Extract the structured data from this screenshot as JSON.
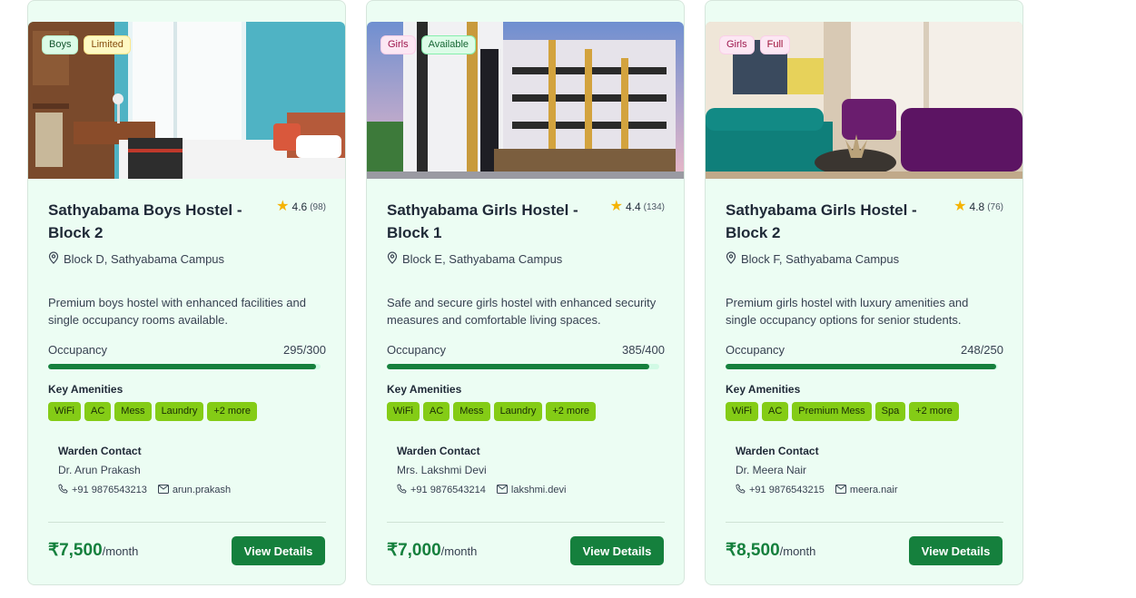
{
  "hostels": [
    {
      "gender_badge": "Boys",
      "status_badge": "Limited",
      "title": "Sathyabama Boys Hostel - Block 2",
      "rating": "4.6",
      "reviews": "(98)",
      "location": "Block D, Sathyabama Campus",
      "description": "Premium boys hostel with enhanced facilities and single occupancy rooms available.",
      "occupancy_label": "Occupancy",
      "occupancy_value": "295/300",
      "occupancy_fraction": 0.983,
      "amenities_title": "Key Amenities",
      "amenities": [
        "WiFi",
        "AC",
        "Mess",
        "Laundry",
        "+2 more"
      ],
      "warden_title": "Warden Contact",
      "warden_name": "Dr. Arun Prakash",
      "warden_phone": "+91 9876543213",
      "warden_email": "arun.prakash",
      "price": "₹7,500",
      "per": "/month",
      "button": "View Details"
    },
    {
      "gender_badge": "Girls",
      "status_badge": "Available",
      "title": "Sathyabama Girls Hostel - Block 1",
      "rating": "4.4",
      "reviews": "(134)",
      "location": "Block E, Sathyabama Campus",
      "description": "Safe and secure girls hostel with enhanced security measures and comfortable living spaces.",
      "occupancy_label": "Occupancy",
      "occupancy_value": "385/400",
      "occupancy_fraction": 0.9625,
      "amenities_title": "Key Amenities",
      "amenities": [
        "WiFi",
        "AC",
        "Mess",
        "Laundry",
        "+2 more"
      ],
      "warden_title": "Warden Contact",
      "warden_name": "Mrs. Lakshmi Devi",
      "warden_phone": "+91 9876543214",
      "warden_email": "lakshmi.devi",
      "price": "₹7,000",
      "per": "/month",
      "button": "View Details"
    },
    {
      "gender_badge": "Girls",
      "status_badge": "Full",
      "title": "Sathyabama Girls Hostel - Block 2",
      "rating": "4.8",
      "reviews": "(76)",
      "location": "Block F, Sathyabama Campus",
      "description": "Premium girls hostel with luxury amenities and single occupancy options for senior students.",
      "occupancy_label": "Occupancy",
      "occupancy_value": "248/250",
      "occupancy_fraction": 0.992,
      "amenities_title": "Key Amenities",
      "amenities": [
        "WiFi",
        "AC",
        "Premium Mess",
        "Spa",
        "+2 more"
      ],
      "warden_title": "Warden Contact",
      "warden_name": "Dr. Meera Nair",
      "warden_phone": "+91 9876543215",
      "warden_email": "meera.nair",
      "price": "₹8,500",
      "per": "/month",
      "button": "View Details"
    }
  ],
  "icons": {
    "star": "star-icon",
    "location": "map-pin-icon",
    "phone": "phone-icon",
    "email": "mail-icon"
  },
  "colors": {
    "accent": "#15803d",
    "chip": "#84cc16",
    "card_bg": "#ecfdf3"
  }
}
